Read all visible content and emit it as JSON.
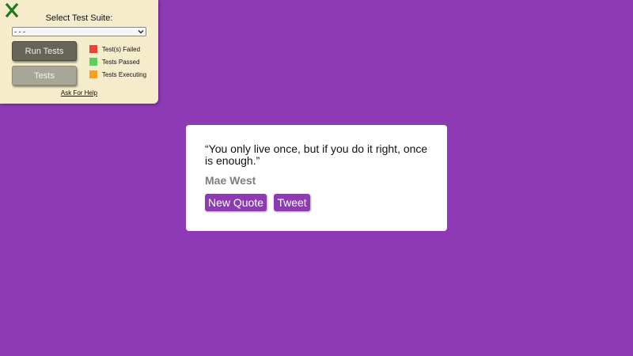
{
  "test_panel": {
    "close_icon": "close-x-icon",
    "title": "Select Test Suite:",
    "select_value": "- - -",
    "run_button": "Run Tests",
    "tests_button": "Tests",
    "legend": [
      {
        "label": "Test(s) Failed",
        "color": "#ef4136"
      },
      {
        "label": "Tests Passed",
        "color": "#57d35c"
      },
      {
        "label": "Tests Executing",
        "color": "#f6a21a"
      }
    ],
    "help_link": "Ask For Help"
  },
  "quote": {
    "text": "“You only live once, but if you do it right, once is enough.”",
    "author": "Mae West",
    "new_quote_button": "New Quote",
    "tweet_button": "Tweet"
  },
  "colors": {
    "background": "#8e3ab4",
    "panel": "#f4ecca",
    "close_icon": "#1f7a1f"
  }
}
